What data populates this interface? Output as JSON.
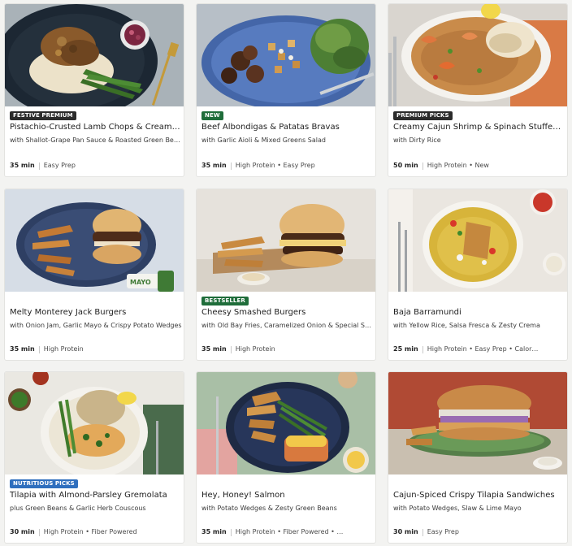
{
  "recipes": [
    {
      "badge": "FESTIVE PREMIUM",
      "badge_color": "#2b2b2b",
      "title": "Pistachio-Crusted Lamb Chops & Cream…",
      "subtitle": "with Shallot-Grape Pan Sauce & Roasted Green Beans",
      "time": "35 min",
      "tags": "Easy Prep"
    },
    {
      "badge": "NEW",
      "badge_color": "#1f6d3a",
      "title": "Beef Albondigas & Patatas Bravas",
      "subtitle": "with Garlic Aioli & Mixed Greens Salad",
      "time": "35 min",
      "tags": "High Protein • Easy Prep"
    },
    {
      "badge": "PREMIUM PICKS",
      "badge_color": "#2b2b2b",
      "title": "Creamy Cajun Shrimp & Spinach Stuffe…",
      "subtitle": "with Dirty Rice",
      "time": "50 min",
      "tags": "High Protein • New"
    },
    {
      "badge": "",
      "title": "Melty Monterey Jack Burgers",
      "subtitle": "with Onion Jam, Garlic Mayo & Crispy Potato Wedges",
      "time": "35 min",
      "tags": "High Protein",
      "image_text": "MAYO"
    },
    {
      "badge": "BESTSELLER",
      "badge_color": "#1f6d3a",
      "title": "Cheesy Smashed Burgers",
      "subtitle": "with Old Bay Fries, Caramelized Onion & Special Sa…",
      "time": "35 min",
      "tags": "High Protein"
    },
    {
      "badge": "",
      "title": "Baja Barramundi",
      "subtitle": "with Yellow Rice, Salsa Fresca & Zesty Crema",
      "time": "25 min",
      "tags": "High Protein • Easy Prep • Calor…"
    },
    {
      "badge": "NUTRITIOUS PICKS",
      "badge_color": "#2f6fbe",
      "title": "Tilapia with Almond-Parsley Gremolata",
      "subtitle": "plus Green Beans & Garlic Herb Couscous",
      "time": "30 min",
      "tags": "High Protein • Fiber Powered"
    },
    {
      "badge": "",
      "title": "Hey, Honey! Salmon",
      "subtitle": "with Potato Wedges & Zesty Green Beans",
      "time": "35 min",
      "tags": "High Protein • Fiber Powered • …"
    },
    {
      "badge": "",
      "title": "Cajun-Spiced Crispy Tilapia Sandwiches",
      "subtitle": "with Potato Wedges, Slaw & Lime Mayo",
      "time": "30 min",
      "tags": "Easy Prep"
    }
  ]
}
